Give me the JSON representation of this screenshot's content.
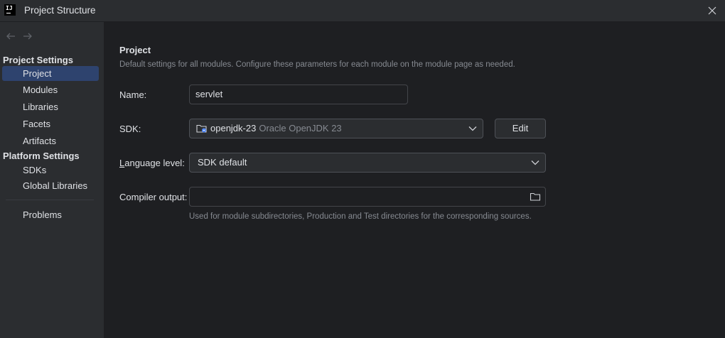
{
  "window": {
    "title": "Project Structure",
    "app_icon_text": "IJ"
  },
  "sidebar": {
    "sections": [
      {
        "title": "Project Settings",
        "items": [
          "Project",
          "Modules",
          "Libraries",
          "Facets",
          "Artifacts"
        ]
      },
      {
        "title": "Platform Settings",
        "items": [
          "SDKs",
          "Global Libraries"
        ]
      }
    ],
    "extra_items": [
      "Problems"
    ],
    "selected": "Project"
  },
  "main": {
    "title": "Project",
    "description": "Default settings for all modules. Configure these parameters for each module on the module page as needed.",
    "name": {
      "label": "Name:",
      "value": "servlet"
    },
    "sdk": {
      "label": "SDK:",
      "name": "openjdk-23",
      "vendor": "Oracle OpenJDK 23",
      "edit_label": "Edit"
    },
    "language_level": {
      "label_first": "L",
      "label_rest": "anguage level:",
      "value": "SDK default"
    },
    "compiler_output": {
      "label": "Compiler output:",
      "value": "",
      "hint": "Used for module subdirectories, Production and Test directories for the corresponding sources."
    }
  },
  "colors": {
    "selection": "#2e436e",
    "accent": "#548af7"
  }
}
